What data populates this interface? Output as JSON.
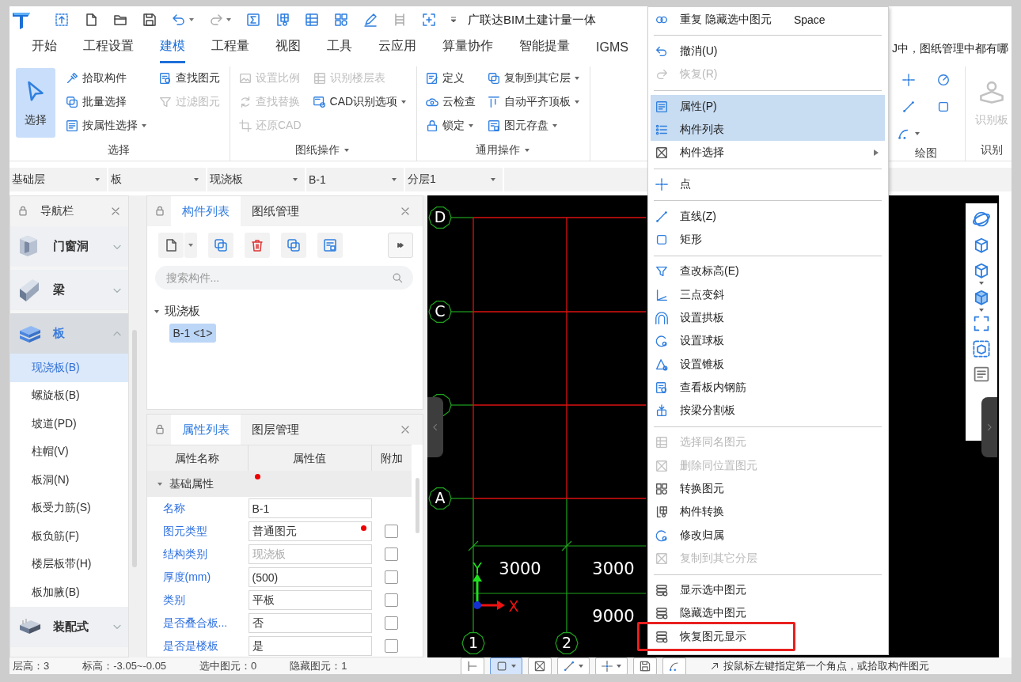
{
  "title_bar": {
    "title": "广联达BIM土建计量一体"
  },
  "ribbon_tabs": [
    {
      "label": "开始",
      "selected": false
    },
    {
      "label": "工程设置",
      "selected": false
    },
    {
      "label": "建模",
      "selected": true
    },
    {
      "label": "工程量",
      "selected": false
    },
    {
      "label": "视图",
      "selected": false
    },
    {
      "label": "工具",
      "selected": false
    },
    {
      "label": "云应用",
      "selected": false
    },
    {
      "label": "算量协作",
      "selected": false
    },
    {
      "label": "智能提量",
      "selected": false
    },
    {
      "label": "IGMS",
      "selected": false
    }
  ],
  "ribbon_hint": "J中，图纸管理中都有哪",
  "ribbon_groups": [
    {
      "label": "选择",
      "has_menu": false,
      "columns": [
        [
          {
            "label": "选择",
            "kind": "large",
            "active": true,
            "disabled": false,
            "dropdown": false
          }
        ],
        [
          {
            "label": "拾取构件",
            "kind": "small",
            "active": false,
            "disabled": false,
            "dropdown": false
          },
          {
            "label": "批量选择",
            "kind": "small",
            "active": false,
            "disabled": false,
            "dropdown": false
          },
          {
            "label": "按属性选择",
            "kind": "small",
            "active": false,
            "disabled": false,
            "dropdown": true
          }
        ],
        [
          {
            "label": "查找图元",
            "kind": "small",
            "active": false,
            "disabled": false,
            "dropdown": false
          },
          {
            "label": "过滤图元",
            "kind": "small",
            "active": false,
            "disabled": true,
            "dropdown": false
          }
        ]
      ]
    },
    {
      "label": "图纸操作",
      "has_menu": true,
      "columns": [
        [
          {
            "label": "设置比例",
            "kind": "small",
            "active": false,
            "disabled": true,
            "dropdown": false
          },
          {
            "label": "查找替换",
            "kind": "small",
            "active": false,
            "disabled": true,
            "dropdown": false
          },
          {
            "label": "还原CAD",
            "kind": "small",
            "active": false,
            "disabled": true,
            "dropdown": false
          }
        ],
        [
          {
            "label": "识别楼层表",
            "kind": "small",
            "active": false,
            "disabled": true,
            "dropdown": false
          },
          {
            "label": "CAD识别选项",
            "kind": "small",
            "active": false,
            "disabled": false,
            "dropdown": true
          }
        ]
      ]
    },
    {
      "label": "通用操作",
      "has_menu": true,
      "columns": [
        [
          {
            "label": "定义",
            "kind": "small",
            "active": false,
            "disabled": false,
            "dropdown": false
          },
          {
            "label": "云检查",
            "kind": "small",
            "active": false,
            "disabled": false,
            "dropdown": false
          },
          {
            "label": "锁定",
            "kind": "small",
            "active": false,
            "disabled": false,
            "dropdown": true
          }
        ],
        [
          {
            "label": "复制到其它层",
            "kind": "small",
            "active": false,
            "disabled": false,
            "dropdown": true
          },
          {
            "label": "自动平齐顶板",
            "kind": "small",
            "active": false,
            "disabled": false,
            "dropdown": true
          },
          {
            "label": "图元存盘",
            "kind": "small",
            "active": false,
            "disabled": false,
            "dropdown": true
          }
        ]
      ]
    }
  ],
  "ribbon_groups_right": [
    {
      "label": "绘图",
      "has_menu": false,
      "columns": [
        [
          {
            "kind": "icon",
            "active": false,
            "disabled": false,
            "dropdown": false
          },
          {
            "kind": "icon",
            "active": false,
            "disabled": false,
            "dropdown": false
          },
          {
            "kind": "icon",
            "active": false,
            "disabled": false,
            "dropdown": true
          }
        ],
        [
          {
            "kind": "icon",
            "active": false,
            "disabled": false,
            "dropdown": false
          },
          {
            "kind": "icon",
            "active": false,
            "disabled": false,
            "dropdown": false
          }
        ]
      ]
    },
    {
      "label": "识别",
      "has_menu": false,
      "columns": [
        [
          {
            "label": "识别板",
            "kind": "large",
            "active": false,
            "disabled": true,
            "dropdown": false
          }
        ]
      ]
    }
  ],
  "selectors": [
    "基础层",
    "板",
    "现浇板",
    "B-1",
    "分层1"
  ],
  "nav_panel": {
    "title": "导航栏",
    "categories": [
      {
        "label": "门窗洞",
        "expanded": false,
        "selected": false
      },
      {
        "label": "梁",
        "expanded": false,
        "selected": false
      },
      {
        "label": "板",
        "expanded": true,
        "selected": true,
        "children": [
          {
            "label": "现浇板(B)",
            "selected": true
          },
          {
            "label": "螺旋板(B)",
            "selected": false
          },
          {
            "label": "坡道(PD)",
            "selected": false
          },
          {
            "label": "柱帽(V)",
            "selected": false
          },
          {
            "label": "板洞(N)",
            "selected": false
          },
          {
            "label": "板受力筋(S)",
            "selected": false
          },
          {
            "label": "板负筋(F)",
            "selected": false
          },
          {
            "label": "楼层板带(H)",
            "selected": false
          },
          {
            "label": "板加腋(B)",
            "selected": false
          }
        ]
      },
      {
        "label": "装配式",
        "expanded": false,
        "selected": false
      }
    ]
  },
  "component_panel": {
    "tabs": [
      {
        "label": "构件列表",
        "selected": true
      },
      {
        "label": "图纸管理",
        "selected": false
      }
    ],
    "search": {
      "placeholder": "搜索构件..."
    },
    "tree": [
      {
        "label": "现浇板",
        "expanded": true,
        "selected": false,
        "children": [
          {
            "label": "B-1 <1>",
            "selected": true
          }
        ]
      }
    ]
  },
  "property_panel": {
    "tabs": [
      {
        "label": "属性列表",
        "selected": true
      },
      {
        "label": "图层管理",
        "selected": false
      }
    ],
    "columns": [
      "属性名称",
      "属性值",
      "附加"
    ],
    "groups": [
      {
        "label": "基础属性",
        "expanded": true,
        "flagged": true,
        "rows": [
          {
            "kind": "field",
            "name": "名称",
            "value": "B-1",
            "flagged": false,
            "readonly": false
          },
          {
            "kind": "field-check",
            "name": "图元类型",
            "value": "普通图元",
            "flagged": true,
            "readonly": false,
            "checked": false
          },
          {
            "kind": "field-check",
            "name": "结构类别",
            "value": "现浇板",
            "flagged": false,
            "readonly": true,
            "checked": false
          },
          {
            "kind": "field-check",
            "name": "厚度(mm)",
            "value": "(500)",
            "flagged": false,
            "readonly": false,
            "checked": false
          },
          {
            "kind": "field-check",
            "name": "类别",
            "value": "平板",
            "flagged": false,
            "readonly": false,
            "checked": false
          },
          {
            "kind": "field-check",
            "name": "是否叠合板...",
            "value": "否",
            "flagged": false,
            "readonly": false,
            "checked": false
          },
          {
            "kind": "field-check",
            "name": "是否是楼板",
            "value": "是",
            "flagged": false,
            "readonly": false,
            "checked": false
          }
        ]
      }
    ]
  },
  "canvas": {
    "rows": [
      {
        "kind": "labeled",
        "label": "D"
      },
      {
        "kind": "labeled",
        "label": "C"
      },
      {
        "kind": "covered"
      },
      {
        "kind": "labeled",
        "label": "A"
      }
    ],
    "columns": [
      "1",
      "2"
    ],
    "spans": [
      "3000",
      "3000"
    ],
    "total": "9000",
    "axis_x": "X",
    "axis_y": "Y"
  },
  "status_bar": [
    "层高：3",
    "标高：-3.05~-0.05",
    "选中图元：0",
    "隐藏图元：1"
  ],
  "draw_toolbar": {
    "buttons": [
      {
        "selected": false,
        "dropdown": false
      },
      {
        "selected": true,
        "dropdown": true
      },
      {
        "selected": false,
        "dropdown": false
      },
      {
        "selected": false,
        "dropdown": true
      },
      {
        "selected": false,
        "dropdown": true
      },
      {
        "selected": false,
        "dropdown": false
      },
      {
        "selected": false,
        "dropdown": false
      }
    ],
    "hint": "按鼠标左键指定第一个角点，或拾取构件图元"
  },
  "context_menu": [
    {
      "kind": "item",
      "label": "重复 隐藏选中图元",
      "shortcut": "Space",
      "disabled": false,
      "highlighted": false,
      "submenu": false,
      "marked": false
    },
    {
      "kind": "separator"
    },
    {
      "kind": "item",
      "label": "撤消(U)",
      "disabled": false,
      "highlighted": false,
      "submenu": false,
      "marked": false
    },
    {
      "kind": "item",
      "label": "恢复(R)",
      "disabled": true,
      "highlighted": false,
      "submenu": false,
      "marked": false
    },
    {
      "kind": "separator"
    },
    {
      "kind": "item",
      "label": "属性(P)",
      "disabled": false,
      "highlighted": true,
      "submenu": false,
      "marked": false
    },
    {
      "kind": "item",
      "label": "构件列表",
      "disabled": false,
      "highlighted": true,
      "submenu": false,
      "marked": false
    },
    {
      "kind": "item",
      "label": "构件选择",
      "disabled": false,
      "highlighted": false,
      "submenu": true,
      "marked": false
    },
    {
      "kind": "separator"
    },
    {
      "kind": "item",
      "label": "点",
      "disabled": false,
      "highlighted": false,
      "submenu": false,
      "marked": false
    },
    {
      "kind": "separator"
    },
    {
      "kind": "item",
      "label": "直线(Z)",
      "disabled": false,
      "highlighted": false,
      "submenu": false,
      "marked": false
    },
    {
      "kind": "item",
      "label": "矩形",
      "disabled": false,
      "highlighted": false,
      "submenu": false,
      "marked": false
    },
    {
      "kind": "separator"
    },
    {
      "kind": "item",
      "label": "查改标高(E)",
      "disabled": false,
      "highlighted": false,
      "submenu": false,
      "marked": false
    },
    {
      "kind": "item",
      "label": "三点变斜",
      "disabled": false,
      "highlighted": false,
      "submenu": false,
      "marked": false
    },
    {
      "kind": "item",
      "label": "设置拱板",
      "disabled": false,
      "highlighted": false,
      "submenu": false,
      "marked": false
    },
    {
      "kind": "item",
      "label": "设置球板",
      "disabled": false,
      "highlighted": false,
      "submenu": false,
      "marked": false
    },
    {
      "kind": "item",
      "label": "设置锥板",
      "disabled": false,
      "highlighted": false,
      "submenu": false,
      "marked": false
    },
    {
      "kind": "item",
      "label": "查看板内钢筋",
      "disabled": false,
      "highlighted": false,
      "submenu": false,
      "marked": false
    },
    {
      "kind": "item",
      "label": "按梁分割板",
      "disabled": false,
      "highlighted": false,
      "submenu": false,
      "marked": false
    },
    {
      "kind": "separator"
    },
    {
      "kind": "item",
      "label": "选择同名图元",
      "disabled": true,
      "highlighted": false,
      "submenu": false,
      "marked": false
    },
    {
      "kind": "item",
      "label": "删除同位置图元",
      "disabled": true,
      "highlighted": false,
      "submenu": false,
      "marked": false
    },
    {
      "kind": "item",
      "label": "转换图元",
      "disabled": false,
      "highlighted": false,
      "submenu": false,
      "marked": false
    },
    {
      "kind": "item",
      "label": "构件转换",
      "disabled": false,
      "highlighted": false,
      "submenu": false,
      "marked": false
    },
    {
      "kind": "item",
      "label": "修改归属",
      "disabled": false,
      "highlighted": false,
      "submenu": false,
      "marked": false
    },
    {
      "kind": "item",
      "label": "复制到其它分层",
      "disabled": true,
      "highlighted": false,
      "submenu": false,
      "marked": false
    },
    {
      "kind": "separator"
    },
    {
      "kind": "item",
      "label": "显示选中图元",
      "disabled": false,
      "highlighted": false,
      "submenu": false,
      "marked": false
    },
    {
      "kind": "item",
      "label": "隐藏选中图元",
      "disabled": false,
      "highlighted": false,
      "submenu": false,
      "marked": false
    },
    {
      "kind": "item",
      "label": "恢复图元显示",
      "disabled": false,
      "highlighted": false,
      "submenu": false,
      "marked": true
    }
  ]
}
